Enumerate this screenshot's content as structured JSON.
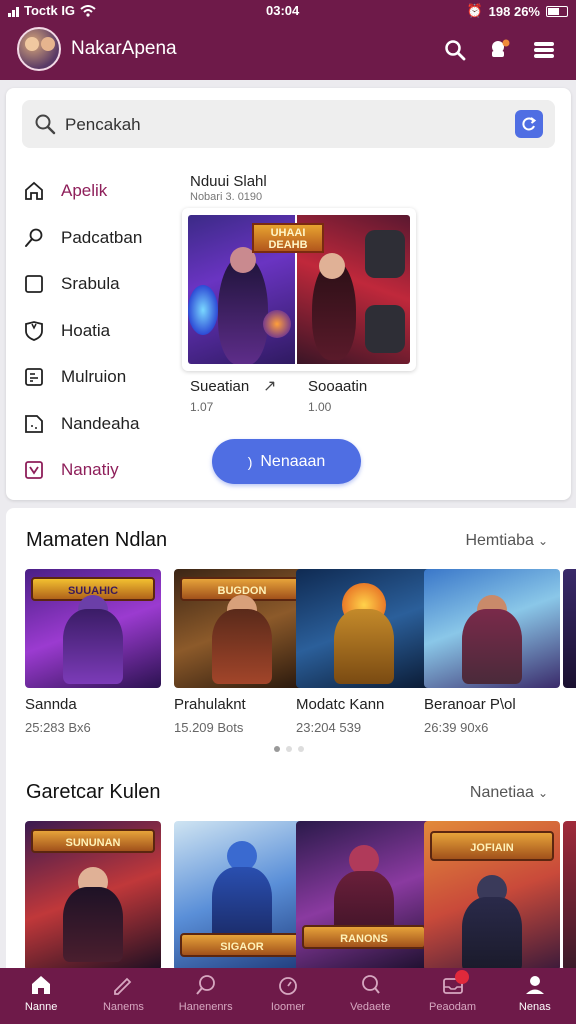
{
  "status": {
    "carrier": "Toctk IG",
    "time": "03:04",
    "battery_text": "198 26%"
  },
  "header": {
    "title": "NakarApena"
  },
  "search": {
    "placeholder": "Pencakah"
  },
  "menu": [
    {
      "label": "Apelik",
      "icon": "home-icon"
    },
    {
      "label": "Padcatban",
      "icon": "search-icon"
    },
    {
      "label": "Srabula",
      "icon": "square-icon"
    },
    {
      "label": "Hoatia",
      "icon": "shield-icon"
    },
    {
      "label": "Mulruion",
      "icon": "document-icon"
    },
    {
      "label": "Nandeaha",
      "icon": "file-icon"
    },
    {
      "label": "Nanatiy",
      "icon": "chevron-box-icon"
    }
  ],
  "featured": {
    "title": "Nduui Slahl",
    "subtitle": "Nobari 3. 0190",
    "banner": "UHAAI DEAHB",
    "left_caption": "Sueatian",
    "left_meta": "1.07",
    "right_caption": "Sooaatin",
    "right_meta": "1.00",
    "button": "Nenaaan"
  },
  "section1": {
    "title": "Mamaten Ndlan",
    "link": "Hemtiaba",
    "tiles": [
      {
        "name": "Sannda",
        "meta": "25:283 Bx6",
        "label": "SUUAHIC"
      },
      {
        "name": "Prahulaknt",
        "meta": "15.209 Bots",
        "label": "BUGDON"
      },
      {
        "name": "Modatc Kann",
        "meta": "23:204 539",
        "label": ""
      },
      {
        "name": "Beranoar P\\ol",
        "meta": "26:39 90x6",
        "label": ""
      }
    ]
  },
  "section2": {
    "title": "Garetcar Kulen",
    "link": "Nanetiaa",
    "tiles": [
      {
        "label": "SUNUNAN"
      },
      {
        "label": "SIGAOR"
      },
      {
        "label": "RANONS"
      },
      {
        "label": "JOFIAIN"
      }
    ]
  },
  "nav": [
    {
      "label": "Nanne",
      "icon": "home-icon",
      "active": true
    },
    {
      "label": "Nanems",
      "icon": "pencil-icon"
    },
    {
      "label": "Hanenenrs",
      "icon": "search-icon"
    },
    {
      "label": "Ioomer",
      "icon": "timer-icon"
    },
    {
      "label": "Vedaete",
      "icon": "search-icon"
    },
    {
      "label": "Peaodam",
      "icon": "inbox-icon"
    },
    {
      "label": "Nenas",
      "icon": "person-icon"
    }
  ],
  "colors": {
    "brand": "#6e1a49",
    "accent": "#4f6ee3",
    "active_menu": "#8e1f5a"
  }
}
